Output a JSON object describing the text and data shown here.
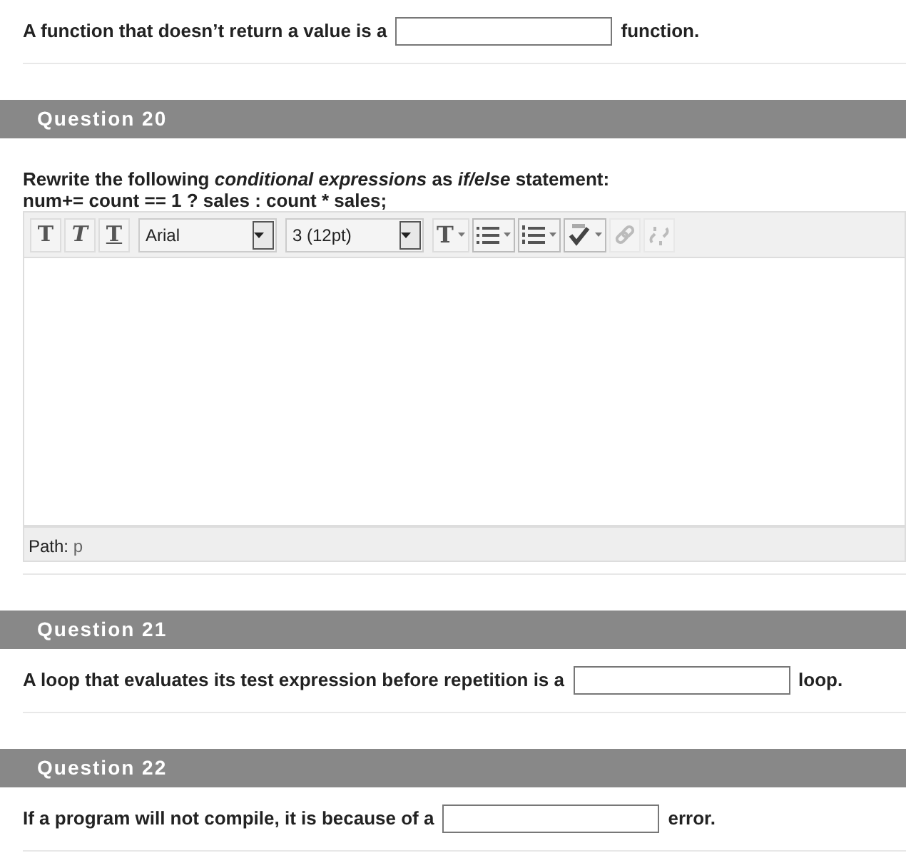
{
  "blocks": [
    {
      "kind": "fill",
      "before": "A function that doesn’t return a value is a",
      "after": "function."
    },
    {
      "kind": "header",
      "title": "Question 20"
    },
    {
      "kind": "essay",
      "prompt": "Rewrite the following *conditional expressions* as *if/else* statement:",
      "code": "num+= count == 1 ? sales : count * sales;",
      "toolbar": [
        {
          "kind": "bold",
          "label": "T"
        },
        {
          "kind": "italic",
          "label": "T"
        },
        {
          "kind": "underline",
          "label": "T"
        },
        {
          "kind": "select",
          "value": "Arial"
        },
        {
          "kind": "select",
          "value": "3 (12pt)"
        },
        {
          "kind": "textcolor",
          "label": "T"
        },
        {
          "kind": "bullets"
        },
        {
          "kind": "numbers"
        },
        {
          "kind": "spell"
        },
        {
          "kind": "link",
          "disabled": true
        },
        {
          "kind": "unlink",
          "disabled": true
        }
      ],
      "path_label": "Path:",
      "path_value": "p"
    },
    {
      "kind": "header",
      "title": "Question 21"
    },
    {
      "kind": "fill",
      "before": "A loop that evaluates its test expression before repetition is a",
      "after": "loop."
    },
    {
      "kind": "header",
      "title": "Question 22"
    },
    {
      "kind": "fill",
      "before": "If a program will not compile, it is because of a",
      "after": "error."
    }
  ]
}
